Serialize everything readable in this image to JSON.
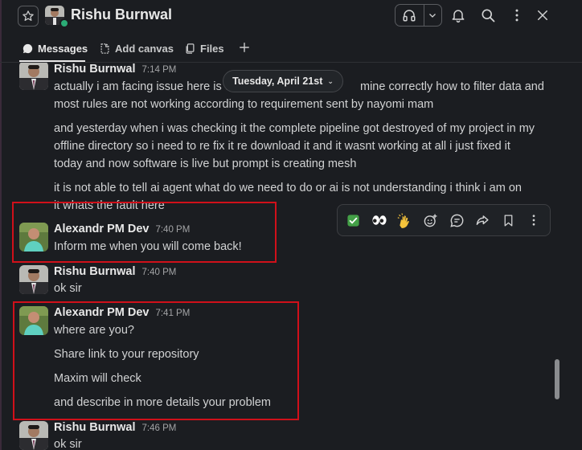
{
  "header": {
    "title": "Rishu Burnwal"
  },
  "tabs": [
    {
      "label": "Messages",
      "icon": "message-icon"
    },
    {
      "label": "Add canvas",
      "icon": "canvas-icon"
    },
    {
      "label": "Files",
      "icon": "files-icon"
    }
  ],
  "date_divider": "Tuesday, April 21st",
  "messages": [
    {
      "author": "Rishu Burnwal",
      "time": "7:14 PM",
      "lines": [
        "actually i am facing issue here is c",
        "mine correctly how to filter data and",
        "most rules are not working according to requirement sent by nayomi mam",
        "and yesterday when i was checking it the complete pipeline got destroyed of my project in my",
        "offline directory so i need to re fix it re download it and it wasnt working at all i just fixed it",
        "today and now software is live but prompt is creating mesh",
        "it is not able to tell ai agent what do we need to do or ai is not understanding i think i  am on",
        "it whats the fault here"
      ]
    },
    {
      "author": "Alexandr PM Dev",
      "time": "7:40 PM",
      "lines": [
        "Inform me when you will come back!"
      ]
    },
    {
      "author": "Rishu Burnwal",
      "time": "7:40 PM",
      "lines": [
        "ok sir"
      ]
    },
    {
      "author": "Alexandr PM Dev",
      "time": "7:41 PM",
      "lines": [
        "where are you?",
        "Share link to your repository",
        "Maxim will check",
        "and describe in more details your problem"
      ]
    },
    {
      "author": "Rishu Burnwal",
      "time": "7:46 PM",
      "lines": [
        "ok sir"
      ]
    }
  ],
  "hover_actions": [
    "check-reaction",
    "eyes-reaction",
    "raised-hands-reaction",
    "add-reaction",
    "reply-thread",
    "forward",
    "bookmark",
    "more"
  ],
  "colors": {
    "background": "#1b1d21",
    "highlight_box": "#d0101a",
    "presence": "#2bac76"
  }
}
